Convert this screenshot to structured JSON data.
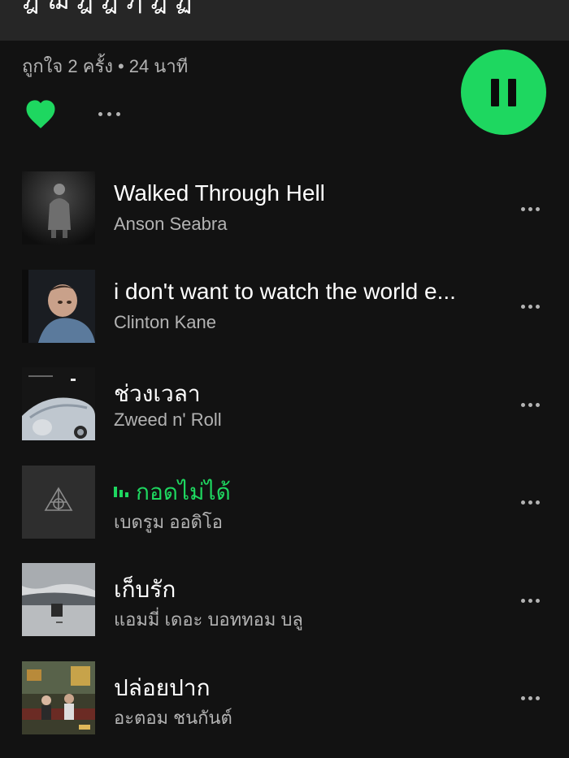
{
  "header": {
    "partial_title": "ฎ ฌ ฎ ฎ ฦ ฎ ฏ"
  },
  "playlist": {
    "likes": "ถูกใจ 2 ครั้ง",
    "separator": "•",
    "duration": "24 นาที",
    "liked": true
  },
  "icons": {
    "heart": "heart-filled-icon",
    "more": "more-horizontal-icon",
    "pause": "pause-icon",
    "now_playing": "equalizer-icon"
  },
  "colors": {
    "accent": "#1ed760",
    "background": "#121212",
    "topbar": "#262626",
    "secondary_text": "#b3b3b3"
  },
  "tracks": [
    {
      "title": "Walked Through Hell",
      "artist": "Anson Seabra",
      "playing": false
    },
    {
      "title": "i don't want to watch the world e...",
      "artist": "Clinton Kane",
      "playing": false
    },
    {
      "title": "ช่วงเวลา",
      "artist": "Zweed n' Roll",
      "playing": false
    },
    {
      "title": "กอดไม่ได้",
      "artist": "เบดรูม ออดิโอ",
      "playing": true
    },
    {
      "title": "เก็บรัก",
      "artist": "แอมมี่ เดอะ บอททอม บลู",
      "playing": false
    },
    {
      "title": "ปล่อยปาก",
      "artist": "อะตอม ชนกันต์",
      "playing": false
    }
  ]
}
